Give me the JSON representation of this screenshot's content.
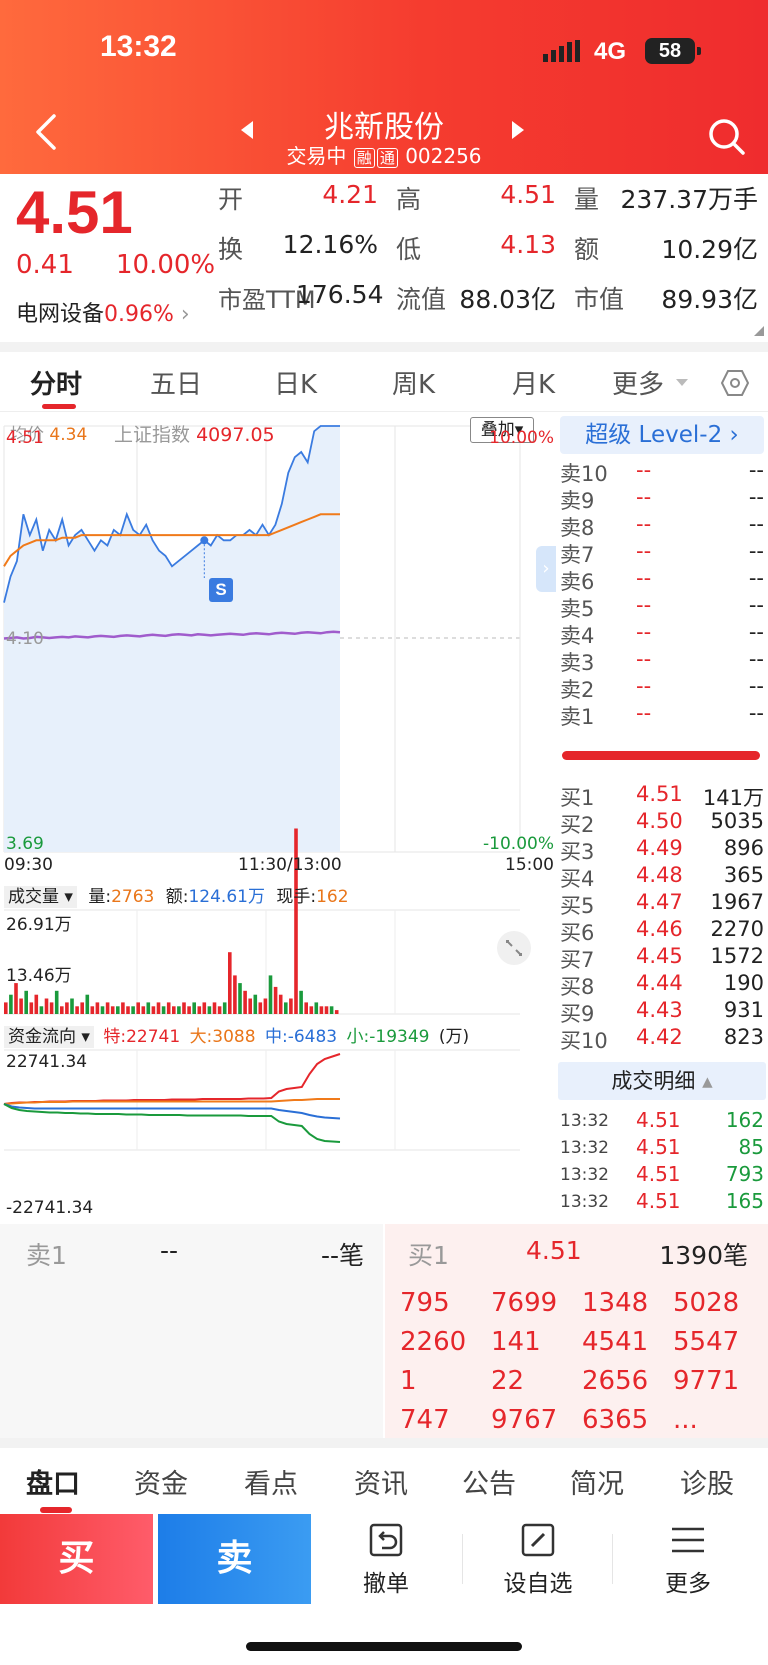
{
  "status_bar": {
    "time": "13:32",
    "network": "4G",
    "battery": "58"
  },
  "header": {
    "title": "兆新股份",
    "status": "交易中",
    "badge1": "融",
    "badge2": "通",
    "code": "002256"
  },
  "quote": {
    "price": "4.51",
    "change": "0.41",
    "change_pct": "10.00%",
    "sector": "电网设备",
    "sector_pct": "0.96%",
    "fields": [
      {
        "label": "开",
        "value": "4.21",
        "color": "red"
      },
      {
        "label": "高",
        "value": "4.51",
        "color": "red"
      },
      {
        "label": "量",
        "value": "237.37万手",
        "color": "black"
      },
      {
        "label": "换",
        "value": "12.16%",
        "color": "black"
      },
      {
        "label": "低",
        "value": "4.13",
        "color": "red"
      },
      {
        "label": "额",
        "value": "10.29亿",
        "color": "black"
      },
      {
        "label": "市盈TTM",
        "value": "176.54",
        "color": "black"
      },
      {
        "label": "流值",
        "value": "88.03亿",
        "color": "black"
      },
      {
        "label": "市值",
        "value": "89.93亿",
        "color": "black"
      }
    ]
  },
  "tabs": [
    "分时",
    "五日",
    "日K",
    "周K",
    "月K",
    "更多"
  ],
  "chart": {
    "avg_label": "均价",
    "avg_value": "4.34",
    "index_label": "上证指数",
    "index_value": "4097.05",
    "overlay_btn": "叠加",
    "y_top": "4.51",
    "y_mid": "4.10",
    "y_bottom": "3.69",
    "pct_top": "10.00%",
    "pct_bottom": "-10.00%",
    "x_start": "09:30",
    "x_mid": "11:30/13:00",
    "x_end": "15:00",
    "marker": "S",
    "vol_label": "成交量",
    "vol_qty_label": "量:",
    "vol_qty": "2763",
    "vol_amt_label": "额:",
    "vol_amt": "124.61万",
    "vol_hand_label": "现手:",
    "vol_hand": "162",
    "vol_top": "26.91万",
    "vol_mid": "13.46万",
    "flow_label": "资金流向",
    "flow_te": "特:22741",
    "flow_da": "大:3088",
    "flow_zhong": "中:-6483",
    "flow_xiao": "小:-19349",
    "flow_unit": "(万)",
    "flow_top": "22741.34",
    "flow_bottom": "-22741.34"
  },
  "chart_data": {
    "type": "line",
    "price_line": [
      4.17,
      4.22,
      4.25,
      4.34,
      4.3,
      4.33,
      4.27,
      4.31,
      4.29,
      4.33,
      4.28,
      4.3,
      4.31,
      4.29,
      4.27,
      4.29,
      4.28,
      4.31,
      4.3,
      4.34,
      4.31,
      4.3,
      4.32,
      4.29,
      4.27,
      4.26,
      4.24,
      4.25,
      4.26,
      4.27,
      4.28,
      4.29,
      4.28,
      4.3,
      4.29,
      4.29,
      4.3,
      4.3,
      4.31,
      4.3,
      4.32,
      4.3,
      4.32,
      4.36,
      4.42,
      4.45,
      4.46,
      4.44,
      4.5,
      4.51,
      4.51,
      4.51,
      4.51
    ],
    "avg_line": [
      4.24,
      4.26,
      4.27,
      4.28,
      4.285,
      4.29,
      4.29,
      4.29,
      4.29,
      4.295,
      4.295,
      4.295,
      4.3,
      4.3,
      4.3,
      4.3,
      4.3,
      4.3,
      4.3,
      4.3,
      4.3,
      4.3,
      4.3,
      4.3,
      4.3,
      4.3,
      4.3,
      4.3,
      4.3,
      4.3,
      4.3,
      4.3,
      4.3,
      4.3,
      4.3,
      4.3,
      4.3,
      4.3,
      4.3,
      4.3,
      4.3,
      4.3,
      4.305,
      4.31,
      4.315,
      4.32,
      4.325,
      4.33,
      4.335,
      4.34,
      4.34,
      4.34,
      4.34
    ],
    "index_line": [
      4.101,
      4.102,
      4.103,
      4.101,
      4.102,
      4.104,
      4.103,
      4.102,
      4.103,
      4.104,
      4.103,
      4.105,
      4.104,
      4.103,
      4.105,
      4.106,
      4.105,
      4.104,
      4.106,
      4.107,
      4.106,
      4.105,
      4.107,
      4.108,
      4.107,
      4.106,
      4.108,
      4.109,
      4.108,
      4.107,
      4.109,
      4.108,
      4.107,
      4.108,
      4.109,
      4.11,
      4.109,
      4.108,
      4.11,
      4.111,
      4.11,
      4.109,
      4.111,
      4.112,
      4.111,
      4.11,
      4.112,
      4.113,
      4.112,
      4.111,
      4.113,
      4.114,
      4.113
    ],
    "ylim": [
      3.69,
      4.51
    ],
    "volume": [
      3,
      5,
      8,
      4,
      6,
      3,
      5,
      2,
      4,
      3,
      6,
      2,
      3,
      4,
      2,
      3,
      5,
      2,
      3,
      2,
      3,
      2,
      2,
      3,
      2,
      2,
      3,
      2,
      3,
      2,
      3,
      2,
      3,
      2,
      2,
      3,
      2,
      3,
      2,
      3,
      2,
      3,
      2,
      3,
      16,
      10,
      8,
      6,
      4,
      5,
      3,
      4,
      10,
      7,
      5,
      3,
      4,
      48,
      6,
      3,
      2,
      3,
      2,
      2,
      2,
      1
    ],
    "vol_max": 26.91,
    "flow_te": [
      0,
      0.02,
      0.03,
      0.03,
      0.04,
      0.04,
      0.05,
      0.05,
      0.05,
      0.06,
      0.06,
      0.06,
      0.06,
      0.07,
      0.07,
      0.07,
      0.07,
      0.08,
      0.08,
      0.08,
      0.08,
      0.08,
      0.09,
      0.09,
      0.09,
      0.09,
      0.1,
      0.1,
      0.1,
      0.1,
      0.1,
      0.1,
      0.11,
      0.11,
      0.11,
      0.12,
      0.25,
      0.3,
      0.32,
      0.34,
      0.6,
      0.8,
      0.9,
      0.95,
      1.0
    ],
    "flow_da": [
      0,
      0.01,
      0.02,
      0.03,
      0.03,
      0.04,
      0.04,
      0.04,
      0.04,
      0.05,
      0.05,
      0.05,
      0.05,
      0.05,
      0.05,
      0.05,
      0.05,
      0.05,
      0.05,
      0.05,
      0.05,
      0.05,
      0.05,
      0.05,
      0.05,
      0.05,
      0.05,
      0.05,
      0.05,
      0.05,
      0.05,
      0.05,
      0.05,
      0.05,
      0.05,
      0.05,
      0.06,
      0.07,
      0.08,
      0.08,
      0.09,
      0.1,
      0.1,
      0.1,
      0.1
    ],
    "flow_zhong": [
      0,
      -0.05,
      -0.07,
      -0.08,
      -0.09,
      -0.09,
      -0.09,
      -0.09,
      -0.09,
      -0.09,
      -0.09,
      -0.09,
      -0.09,
      -0.09,
      -0.09,
      -0.09,
      -0.09,
      -0.09,
      -0.09,
      -0.09,
      -0.09,
      -0.09,
      -0.09,
      -0.09,
      -0.09,
      -0.09,
      -0.09,
      -0.09,
      -0.09,
      -0.09,
      -0.09,
      -0.09,
      -0.09,
      -0.09,
      -0.09,
      -0.09,
      -0.12,
      -0.14,
      -0.16,
      -0.18,
      -0.22,
      -0.25,
      -0.27,
      -0.28,
      -0.29
    ],
    "flow_xiao": [
      0,
      -0.08,
      -0.12,
      -0.14,
      -0.15,
      -0.16,
      -0.17,
      -0.17,
      -0.18,
      -0.18,
      -0.19,
      -0.19,
      -0.2,
      -0.2,
      -0.2,
      -0.2,
      -0.21,
      -0.21,
      -0.21,
      -0.22,
      -0.22,
      -0.22,
      -0.22,
      -0.22,
      -0.23,
      -0.23,
      -0.23,
      -0.23,
      -0.23,
      -0.23,
      -0.23,
      -0.23,
      -0.24,
      -0.24,
      -0.24,
      -0.24,
      -0.35,
      -0.4,
      -0.42,
      -0.44,
      -0.6,
      -0.7,
      -0.74,
      -0.75,
      -0.76
    ],
    "colors": {
      "price": "#3a7be0",
      "avg": "#f07a1a",
      "index": "#a05ccc",
      "te": "#e5262b",
      "da": "#f07a1a",
      "zhong": "#2a6fd6",
      "xiao": "#1a9a3c"
    }
  },
  "level2": {
    "title": "超级 Level-2",
    "asks": [
      {
        "label": "卖10",
        "price": "--",
        "vol": "--"
      },
      {
        "label": "卖9",
        "price": "--",
        "vol": "--"
      },
      {
        "label": "卖8",
        "price": "--",
        "vol": "--"
      },
      {
        "label": "卖7",
        "price": "--",
        "vol": "--"
      },
      {
        "label": "卖6",
        "price": "--",
        "vol": "--"
      },
      {
        "label": "卖5",
        "price": "--",
        "vol": "--"
      },
      {
        "label": "卖4",
        "price": "--",
        "vol": "--"
      },
      {
        "label": "卖3",
        "price": "--",
        "vol": "--"
      },
      {
        "label": "卖2",
        "price": "--",
        "vol": "--"
      },
      {
        "label": "卖1",
        "price": "--",
        "vol": "--"
      }
    ],
    "bids": [
      {
        "label": "买1",
        "price": "4.51",
        "vol": "141万"
      },
      {
        "label": "买2",
        "price": "4.50",
        "vol": "5035"
      },
      {
        "label": "买3",
        "price": "4.49",
        "vol": "896"
      },
      {
        "label": "买4",
        "price": "4.48",
        "vol": "365"
      },
      {
        "label": "买5",
        "price": "4.47",
        "vol": "1967"
      },
      {
        "label": "买6",
        "price": "4.46",
        "vol": "2270"
      },
      {
        "label": "买7",
        "price": "4.45",
        "vol": "1572"
      },
      {
        "label": "买8",
        "price": "4.44",
        "vol": "190"
      },
      {
        "label": "买9",
        "price": "4.43",
        "vol": "931"
      },
      {
        "label": "买10",
        "price": "4.42",
        "vol": "823"
      }
    ],
    "deals_title": "成交明细",
    "deals": [
      {
        "time": "13:32",
        "price": "4.51",
        "vol": "162"
      },
      {
        "time": "13:32",
        "price": "4.51",
        "vol": "85"
      },
      {
        "time": "13:32",
        "price": "4.51",
        "vol": "793"
      },
      {
        "time": "13:32",
        "price": "4.51",
        "vol": "165"
      }
    ]
  },
  "queue": {
    "sell_label": "卖1",
    "sell_price": "--",
    "sell_count": "--笔",
    "buy_label": "买1",
    "buy_price": "4.51",
    "buy_count": "1390笔",
    "buy_orders": [
      "795",
      "7699",
      "1348",
      "5028",
      "2260",
      "141",
      "4541",
      "5547",
      "1",
      "22",
      "2656",
      "9771",
      "747",
      "9767",
      "6365",
      "..."
    ]
  },
  "bottom_tabs": [
    "盘口",
    "资金",
    "看点",
    "资讯",
    "公告",
    "简况",
    "诊股"
  ],
  "actions": {
    "buy": "买",
    "sell": "卖",
    "cancel": "撤单",
    "watch": "设自选",
    "more": "更多"
  }
}
